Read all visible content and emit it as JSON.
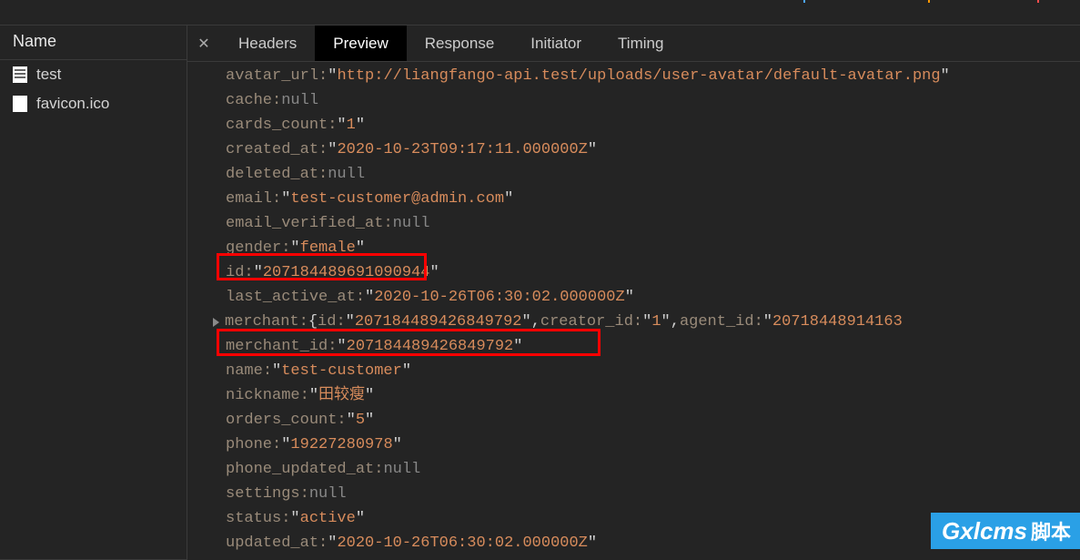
{
  "sidebar": {
    "header": "Name",
    "items": [
      {
        "label": "test",
        "icon": "doc"
      },
      {
        "label": "favicon.ico",
        "icon": "file"
      }
    ]
  },
  "tabs": {
    "headers": "Headers",
    "preview": "Preview",
    "response": "Response",
    "initiator": "Initiator",
    "timing": "Timing"
  },
  "preview": {
    "avatar_key": "avatar_url",
    "avatar_val": "http://liangfango-api.test/uploads/user-avatar/default-avatar.png",
    "cache_key": "cache",
    "cache_val": "null",
    "cards_key": "cards_count",
    "cards_val": "1",
    "created_key": "created_at",
    "created_val": "2020-10-23T09:17:11.000000Z",
    "deleted_key": "deleted_at",
    "deleted_val": "null",
    "email_key": "email",
    "email_val": "test-customer@admin.com",
    "emailv_key": "email_verified_at",
    "emailv_val": "null",
    "gender_key": "gender",
    "gender_val": "female",
    "id_key": "id",
    "id_val": "207184489691090944",
    "last_key": "last_active_at",
    "last_val": "2020-10-26T06:30:02.000000Z",
    "merchant_key": "merchant",
    "merchant_inner_id_key": "id",
    "merchant_inner_id_val": "207184489426849792",
    "merchant_creator_key": "creator_id",
    "merchant_creator_val": "1",
    "merchant_agent_key": "agent_id",
    "merchant_agent_val": "20718448914163",
    "merchantid_key": "merchant_id",
    "merchantid_val": "207184489426849792",
    "name_key": "name",
    "name_val": "test-customer",
    "nick_key": "nickname",
    "nick_val": "田较瘦",
    "orders_key": "orders_count",
    "orders_val": "5",
    "phone_key": "phone",
    "phone_val": "19227280978",
    "phoneu_key": "phone_updated_at",
    "phoneu_val": "null",
    "settings_key": "settings",
    "settings_val": "null",
    "status_key": "status",
    "status_val": "active",
    "updated_key": "updated_at",
    "updated_val": "2020-10-26T06:30:02.000000Z"
  },
  "watermark": {
    "brand": "Gxlcms",
    "suffix": "脚本"
  }
}
